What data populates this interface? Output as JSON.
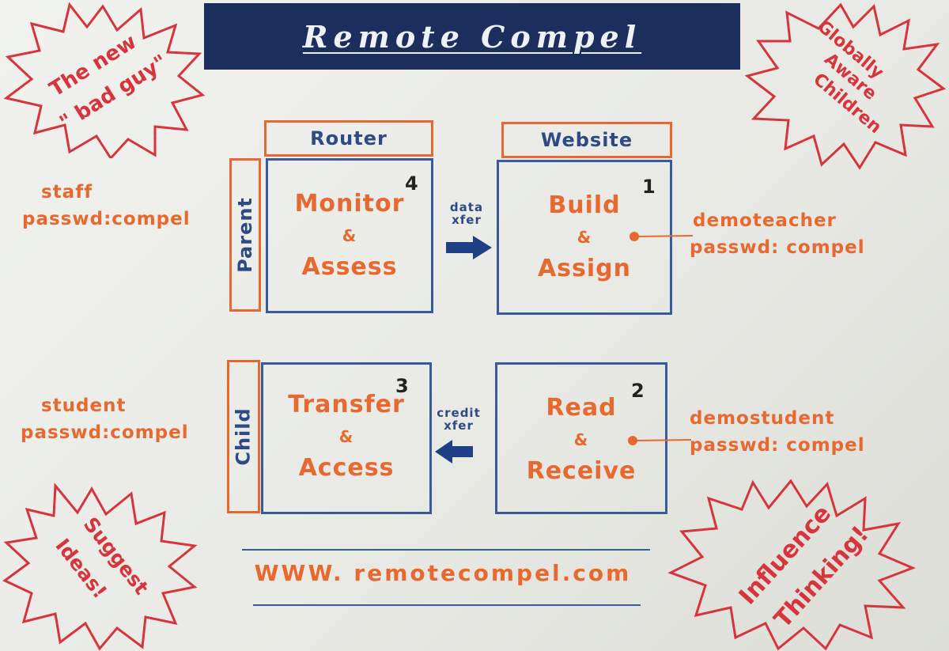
{
  "title": "Remote Compel",
  "columns": {
    "router": "Router",
    "website": "Website"
  },
  "rows": {
    "parent": "Parent",
    "child": "Child"
  },
  "boxes": {
    "monitor": {
      "number": "4",
      "line1": "Monitor",
      "amp": "&",
      "line2": "Assess"
    },
    "build": {
      "number": "1",
      "line1": "Build",
      "amp": "&",
      "line2": "Assign"
    },
    "transfer": {
      "number": "3",
      "line1": "Transfer",
      "amp": "&",
      "line2": "Access"
    },
    "read": {
      "number": "2",
      "line1": "Read",
      "amp": "&",
      "line2": "Receive"
    }
  },
  "arrows": {
    "data_xfer": {
      "line1": "data",
      "line2": "xfer"
    },
    "credit_xfer": {
      "line1": "credit",
      "line2": "xfer"
    }
  },
  "credentials": {
    "staff": {
      "user": "staff",
      "pass": "passwd:compel"
    },
    "student": {
      "user": "student",
      "pass": "passwd:compel"
    },
    "demoteacher": {
      "user": "demoteacher",
      "pass": "passwd: compel"
    },
    "demostudent": {
      "user": "demostudent",
      "pass": "passwd: compel"
    }
  },
  "bursts": {
    "bad_guy": {
      "line1": "The new",
      "line2": "\" bad guy\""
    },
    "global": {
      "line1": "Globally",
      "line2": "Aware",
      "line3": "Children"
    },
    "suggest": {
      "line1": "Suggest",
      "line2": "Ideas!"
    },
    "influence": {
      "line1": "Influence",
      "line2": "Thinking!"
    }
  },
  "url": "WWW. remotecompel.com",
  "colors": {
    "orange": "#e8692f",
    "blue": "#2e4a86",
    "red": "#d8343c",
    "banner": "#1c2e5e"
  }
}
